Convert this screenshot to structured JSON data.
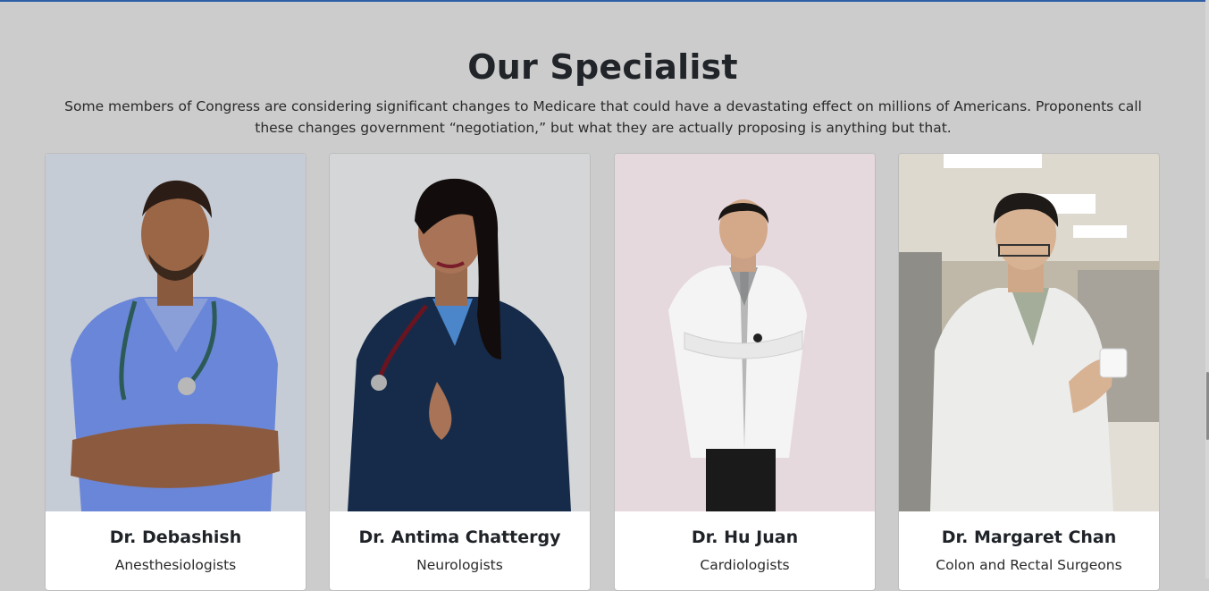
{
  "section": {
    "title": "Our Specialist",
    "description": "Some members of Congress are considering significant changes to Medicare that could have a devastating effect on millions of Americans. Proponents call these changes government “negotiation,” but what they are actually proposing is anything but that."
  },
  "specialists": [
    {
      "name": "Dr. Debashish",
      "specialty": "Anesthesiologists",
      "photo": "doctor-blue-scrubs-stethoscope-photo"
    },
    {
      "name": "Dr. Antima Chattergy",
      "specialty": "Neurologists",
      "photo": "doctor-navy-scrubs-stethoscope-photo"
    },
    {
      "name": "Dr. Hu Juan",
      "specialty": "Cardiologists",
      "photo": "doctor-white-coat-arms-crossed-photo"
    },
    {
      "name": "Dr. Margaret Chan",
      "specialty": "Colon and Rectal Surgeons",
      "photo": "doctor-pharmacy-holding-pill-bottle-photo"
    }
  ],
  "colors": {
    "background": "#cccccc",
    "card": "#ffffff",
    "accent_line": "#2e5fa6",
    "heading": "#212529"
  }
}
